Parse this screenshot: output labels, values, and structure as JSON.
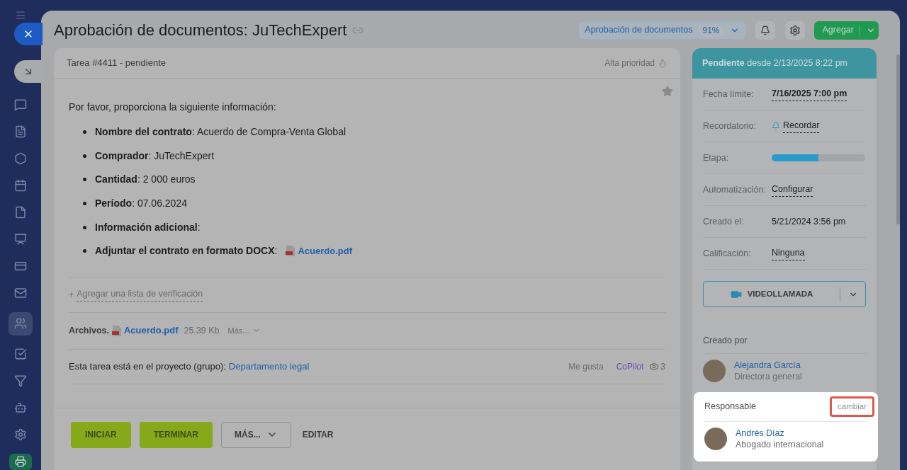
{
  "window": {
    "title": "Aprobación de documentos: JuTechExpert"
  },
  "header": {
    "template": {
      "label": "Aprobación de documentos",
      "percent": "91%"
    },
    "add_button": "Agregar"
  },
  "task": {
    "heading": "Tarea #4411 - pendiente",
    "priority": "Alta prioridad",
    "intro": "Por favor, proporciona la siguiente información:",
    "items": [
      {
        "label": "Nombre del contrato",
        "value": ": Acuerdo de Compra-Venta Global"
      },
      {
        "label": "Comprador",
        "value": ": JuTechExpert"
      },
      {
        "label": "Cantidad",
        "value": ": 2 000 euros"
      },
      {
        "label": "Período",
        "value": ": 07.06.2024"
      },
      {
        "label": "Información adicional",
        "value": ":"
      },
      {
        "label": "Adjuntar el contrato en formato DOCX",
        "value": ":",
        "attachment": "Acuerdo.pdf"
      }
    ],
    "checklist": {
      "plus": "+",
      "label": "Agregar una lista de verificación"
    },
    "files": {
      "label": "Archivos.",
      "name": "Acuerdo.pdf",
      "size": "25.39 Kb",
      "more": "Más..."
    },
    "project": {
      "text": "Esta tarea está en el proyecto (grupo):",
      "link": "Departamento legal"
    },
    "social": {
      "like": "Me gusta",
      "user": "CoPilot",
      "views": "3"
    },
    "buttons": [
      {
        "label": "INICIAR",
        "kind": "primary"
      },
      {
        "label": "TERMINAR",
        "kind": "primary"
      },
      {
        "label": "MÁS...",
        "kind": "dropdown"
      },
      {
        "label": "EDITAR",
        "kind": "link"
      }
    ]
  },
  "sidebar": {
    "status": "Pendiente",
    "since": "desde 2/13/2025 8:22 pm",
    "fields": [
      {
        "label": "Fecha límite:",
        "value": "7/16/2025 7:00 pm",
        "kind": "deadline"
      },
      {
        "label": "Recordatorio:",
        "value": "Recordar",
        "kind": "reminder"
      },
      {
        "label": "Etapa:",
        "kind": "stage",
        "level": 0.5
      },
      {
        "label": "Automatización:",
        "value": "Configurar",
        "kind": "link"
      },
      {
        "label": "Creado el:",
        "value": "5/21/2024 3:56 pm",
        "kind": "text"
      },
      {
        "label": "Calificación:",
        "value": "Ninguna",
        "kind": "link"
      }
    ],
    "videocall": "VIDEOLLAMADA",
    "creator": {
      "heading": "Creado por",
      "name": "Alejandra García",
      "role": "Directora general"
    },
    "responsible": {
      "heading": "Responsable",
      "change": "cambiar",
      "name": "Andrés Díaz",
      "role": "Abogado internacional",
      "highlighted": true
    }
  }
}
